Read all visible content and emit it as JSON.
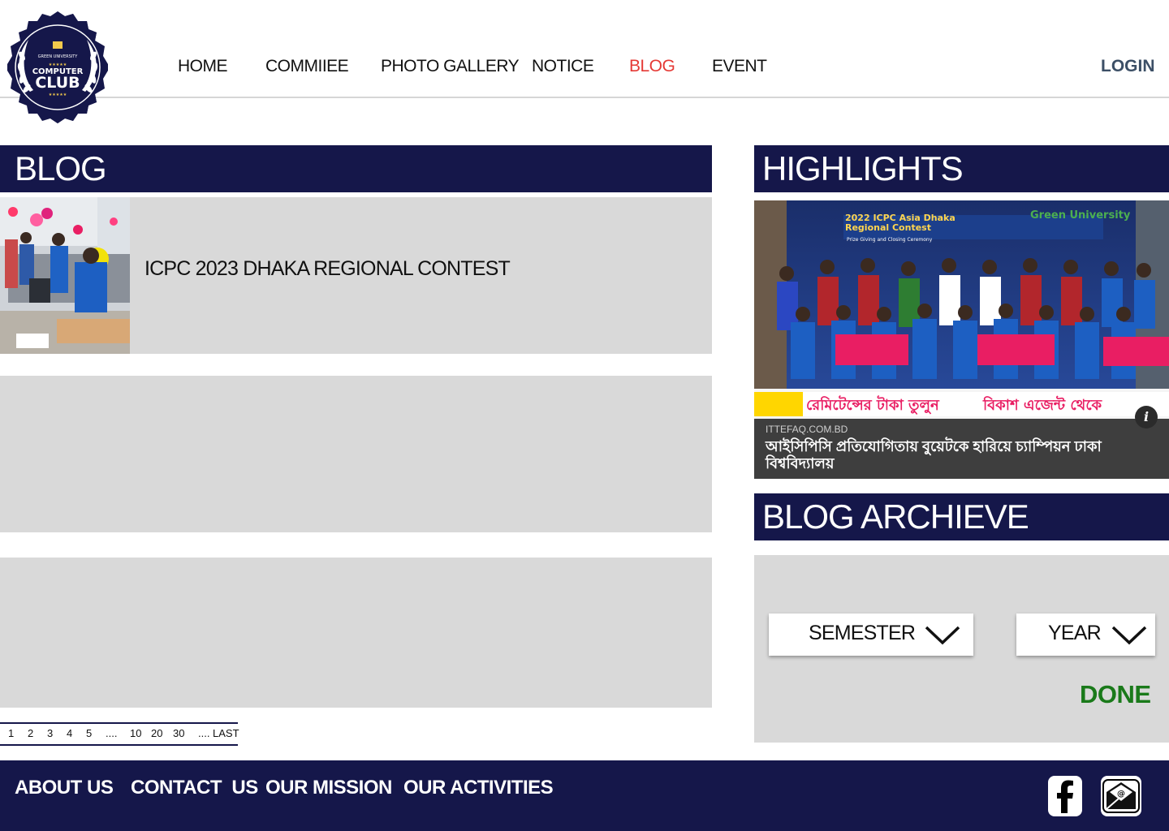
{
  "header": {
    "logo": {
      "top_text": "GREEN UNIVERSITY",
      "middle_text": "COMPUTER",
      "bottom_text": "CLUB"
    },
    "nav": [
      {
        "label": "HOME",
        "active": false
      },
      {
        "label": "COMMIIEE",
        "active": false
      },
      {
        "label": "PHOTO GALLERY",
        "active": false
      },
      {
        "label": "NOTICE",
        "active": false
      },
      {
        "label": "BLOG",
        "active": true
      },
      {
        "label": "EVENT",
        "active": false
      }
    ],
    "login_label": "LOGIN",
    "active_color": "#e53935"
  },
  "blog": {
    "section_title": "BLOG",
    "posts": [
      {
        "title": "ICPC 2023 DHAKA REGIONAL CONTEST",
        "image": "contest-hall-photo"
      },
      {
        "title": "",
        "image": ""
      },
      {
        "title": "",
        "image": ""
      }
    ],
    "pagination": [
      "1",
      "2",
      "3",
      "4",
      "5",
      "....",
      "10",
      "20",
      "30",
      "....",
      "LAST"
    ]
  },
  "highlights": {
    "section_title": "HIGHLIGHTS",
    "banner_title_line1": "2022 ICPC Asia Dhaka",
    "banner_title_line2": "Regional Contest",
    "banner_subtitle": "Prize Giving and Closing Ceremony",
    "banner_sponsor": "Green University",
    "ad_text": "রেমিটেন্সের টাকা তুলুন",
    "ad_text_highlight": "বিকাশ এজেন্ট থেকে",
    "source": "ITTEFAQ.COM.BD",
    "headline": "আইসিপিসি প্রতিযোগিতায় বুয়েটকে হারিয়ে চ্যাম্পিয়ন ঢাকা বিশ্ববিদ্যালয়"
  },
  "archive": {
    "section_title": "BLOG ARCHIEVE",
    "semester_label": "SEMESTER",
    "year_label": "YEAR",
    "done_label": "DONE"
  },
  "footer": {
    "links": [
      "ABOUT US",
      "CONTACT  US",
      "OUR MISSION",
      "OUR ACTIVITIES"
    ],
    "icons": [
      "facebook-icon",
      "email-icon"
    ]
  },
  "colors": {
    "navy": "#15174a",
    "card_gray": "#d9d9d9",
    "done_green": "#1a7a1a",
    "login_slate": "#3c4f66"
  }
}
